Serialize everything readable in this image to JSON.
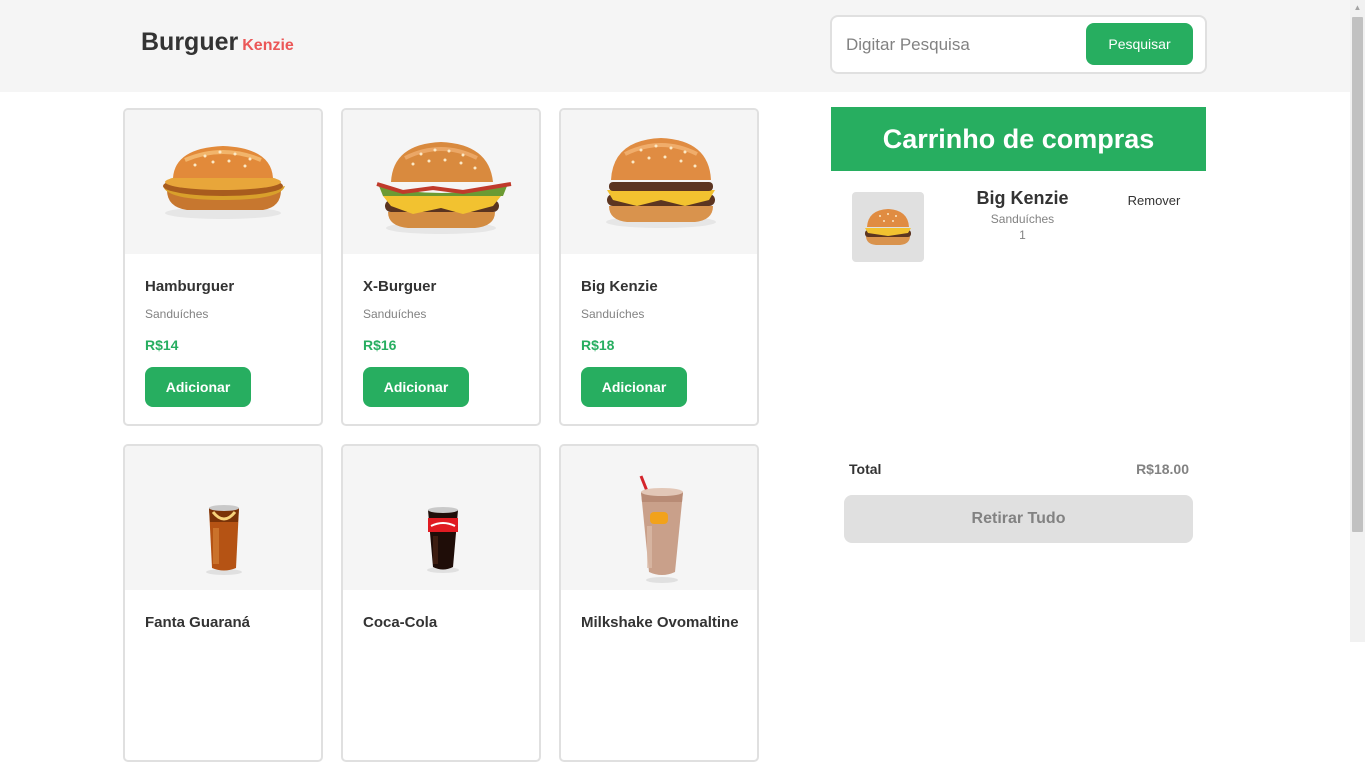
{
  "header": {
    "logo_main": "Burguer",
    "logo_accent": "Kenzie",
    "search_placeholder": "Digitar Pesquisa",
    "search_button": "Pesquisar"
  },
  "products": [
    {
      "name": "Hamburguer",
      "category": "Sanduíches",
      "price": "R$14",
      "button": "Adicionar",
      "image": "hamburger-image"
    },
    {
      "name": "X-Burguer",
      "category": "Sanduíches",
      "price": "R$16",
      "button": "Adicionar",
      "image": "x-burger-image"
    },
    {
      "name": "Big Kenzie",
      "category": "Sanduíches",
      "price": "R$18",
      "button": "Adicionar",
      "image": "big-kenzie-image"
    },
    {
      "name": "Fanta Guaraná",
      "image": "fanta-guarana-glass-image"
    },
    {
      "name": "Coca-Cola",
      "image": "coca-cola-glass-image"
    },
    {
      "name": "Milkshake Ovomaltine",
      "image": "milkshake-image"
    }
  ],
  "cart": {
    "title": "Carrinho de compras",
    "items": [
      {
        "name": "Big Kenzie",
        "category": "Sanduíches",
        "quantity": "1",
        "remove_label": "Remover",
        "image": "big-kenzie-image"
      }
    ],
    "total_label": "Total",
    "total_value": "R$18.00",
    "clear_button": "Retirar Tudo"
  },
  "colors": {
    "primary": "#27ae60",
    "accent": "#eb5757",
    "header_bg": "#f5f5f5",
    "gray_text": "#828282"
  }
}
